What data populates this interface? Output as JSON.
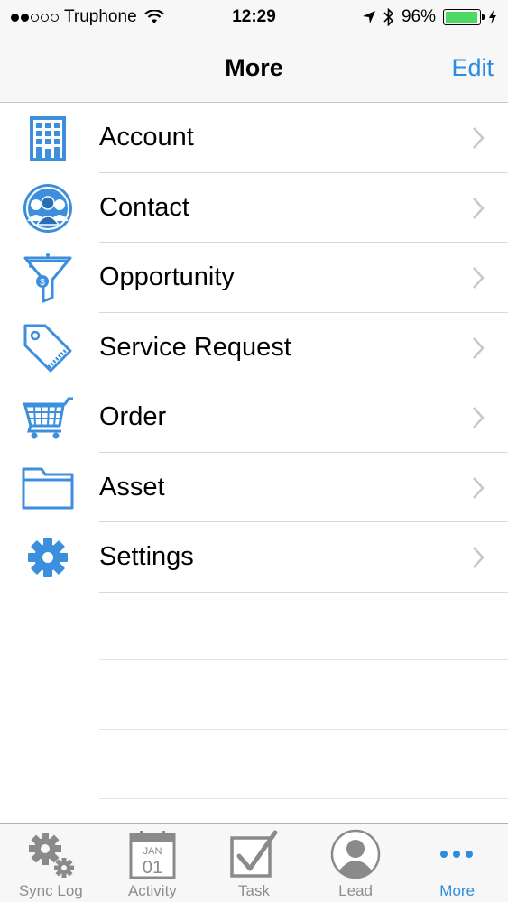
{
  "status_bar": {
    "carrier": "Truphone",
    "time": "12:29",
    "battery": "96%",
    "battery_level": 0.96
  },
  "nav": {
    "title": "More",
    "edit_label": "Edit"
  },
  "menu": {
    "items": [
      {
        "label": "Account",
        "icon": "building-icon"
      },
      {
        "label": "Contact",
        "icon": "contacts-icon"
      },
      {
        "label": "Opportunity",
        "icon": "funnel-icon"
      },
      {
        "label": "Service Request",
        "icon": "tag-icon"
      },
      {
        "label": "Order",
        "icon": "cart-icon"
      },
      {
        "label": "Asset",
        "icon": "folder-icon"
      },
      {
        "label": "Settings",
        "icon": "gear-icon"
      }
    ]
  },
  "tabs": [
    {
      "label": "Sync Log",
      "icon": "gears-icon",
      "active": false
    },
    {
      "label": "Activity",
      "icon": "calendar-icon",
      "calendar_month": "JAN",
      "calendar_day": "01",
      "active": false
    },
    {
      "label": "Task",
      "icon": "checkbox-icon",
      "active": false
    },
    {
      "label": "Lead",
      "icon": "person-icon",
      "active": false
    },
    {
      "label": "More",
      "icon": "more-dots-icon",
      "active": true
    }
  ],
  "colors": {
    "accent": "#2b8de0",
    "icon_blue": "#3b8fdd",
    "tab_inactive": "#8e8e8e",
    "battery_green": "#4cd964"
  }
}
